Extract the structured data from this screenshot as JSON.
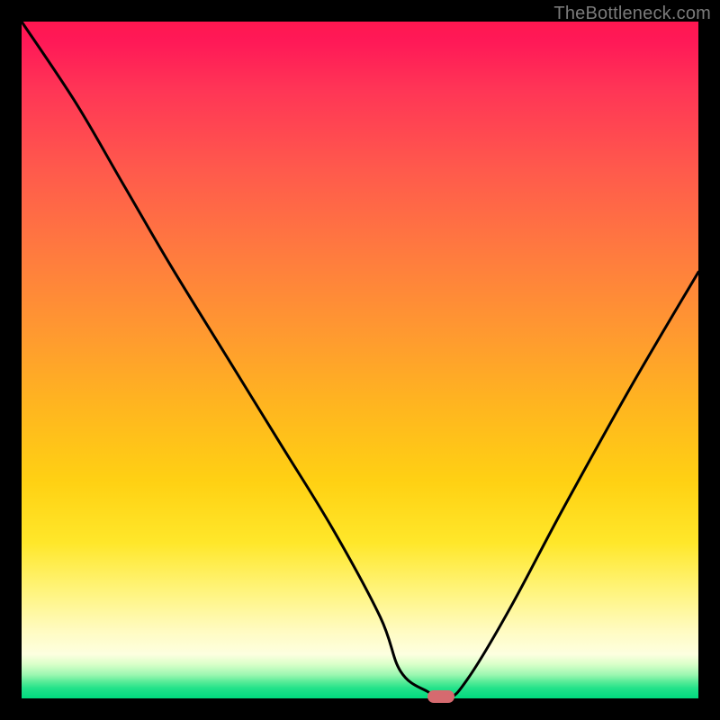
{
  "watermark": "TheBottleneck.com",
  "colors": {
    "frame": "#000000",
    "gradient_top": "#ff1750",
    "gradient_bottom": "#00da7e",
    "curve": "#000000",
    "marker": "#d66a6f"
  },
  "chart_data": {
    "type": "line",
    "title": "",
    "xlabel": "",
    "ylabel": "",
    "xlim": [
      0,
      100
    ],
    "ylim": [
      0,
      100
    ],
    "series": [
      {
        "name": "bottleneck-curve",
        "x": [
          0,
          8,
          15,
          22,
          30,
          38,
          46,
          53,
          56,
          60,
          63,
          66,
          72,
          80,
          90,
          100
        ],
        "values": [
          100,
          88,
          76,
          64,
          51,
          38,
          25,
          12,
          4,
          1,
          0,
          3,
          13,
          28,
          46,
          63
        ]
      }
    ],
    "annotations": [
      {
        "name": "optimum-marker",
        "x": 62,
        "y": 0
      }
    ],
    "grid": false,
    "legend": false
  }
}
